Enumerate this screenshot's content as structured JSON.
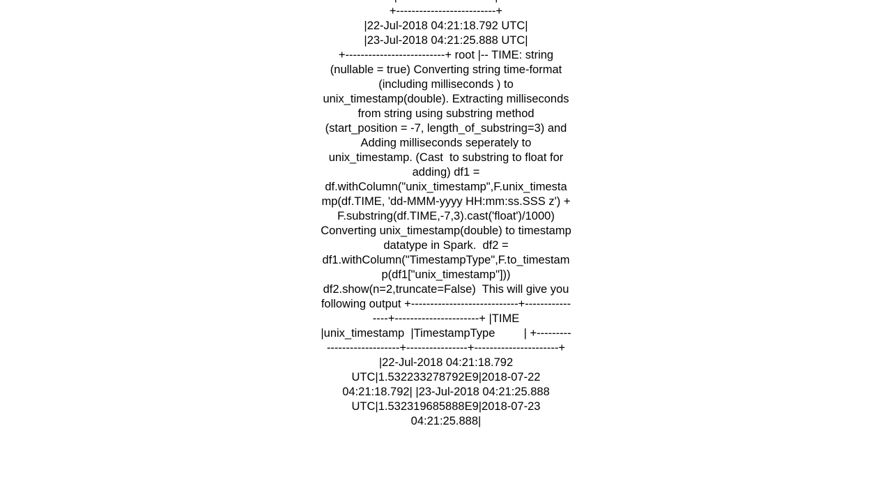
{
  "page": {
    "kind": "plain-text-overflow",
    "background_color": "#ffffff",
    "text_color": "#000000",
    "alignment": "center",
    "clipped_top": true,
    "clipped_bottom": true
  },
  "content": {
    "body_text": "|TIME                      |\n+--------------------------+\n|22-Jul-2018 04:21:18.792 UTC|\n|23-Jul-2018 04:21:25.888 UTC|\n+--------------------------+ root |-- TIME: string (nullable = true) Converting string time-format (including milliseconds ) to unix_timestamp(double). Extracting milliseconds from string using substring method (start_position = -7, length_of_substring=3) and Adding milliseconds seperately to unix_timestamp. (Cast  to substring to float for adding) df1 = df.withColumn(\"unix_timestamp\",F.unix_timestamp(df.TIME, 'dd-MMM-yyyy HH:mm:ss.SSS z') + F.substring(df.TIME,-7,3).cast('float')/1000) Converting unix_timestamp(double) to timestamp datatype in Spark.  df2 = df1.withColumn(\"TimestampType\",F.to_timestamp(df1[\"unix_timestamp\"])) df2.show(n=2,truncate=False)  This will give you following output +----------------------------+----------------+----------------------+ |TIME                        |unix_timestamp  |TimestampType         | +----------------------------+----------------+----------------------+ |22-Jul-2018 04:21:18.792 UTC|1.532233278792E9|2018-07-22 04:21:18.792| |23-Jul-2018 04:21:25.888 UTC|1.532319685888E9|2018-07-23 04:21:25.888|"
  }
}
